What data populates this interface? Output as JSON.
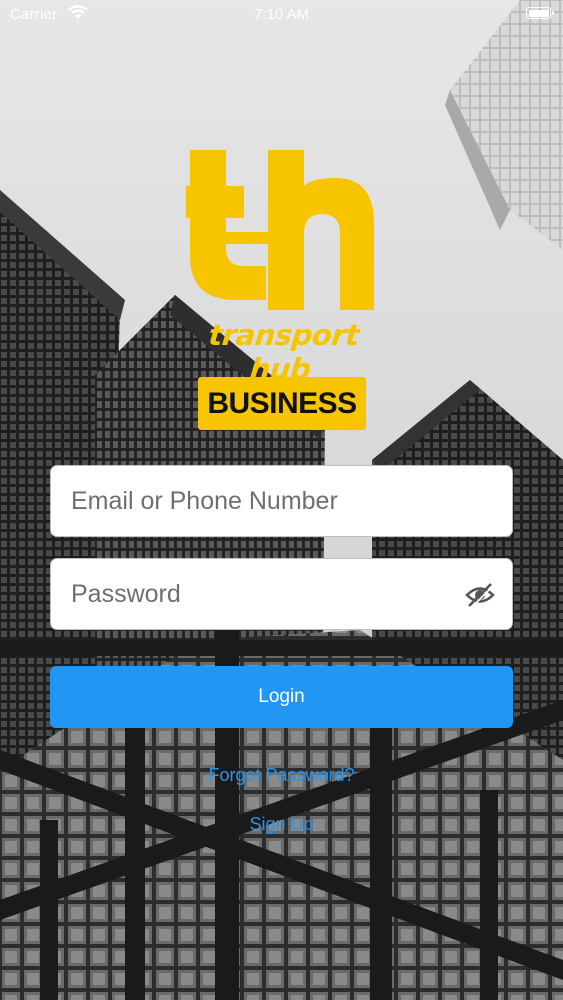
{
  "status_bar": {
    "carrier": "Carrier",
    "time": "7:10 AM",
    "wifi_icon": "wifi-icon",
    "battery_icon": "battery-icon"
  },
  "brand": {
    "logo_icon": "th-logo",
    "name": "transport hub",
    "badge": "BUSINESS",
    "accent_color": "#f6c500"
  },
  "form": {
    "email_placeholder": "Email or Phone Number",
    "email_value": "",
    "password_placeholder": "Password",
    "password_value": "",
    "visibility_icon": "eye-off-icon",
    "login_label": "Login",
    "login_color": "#2196f3"
  },
  "links": {
    "forgot_password": "Forgot Password?",
    "sign_up": "Sign Up"
  }
}
